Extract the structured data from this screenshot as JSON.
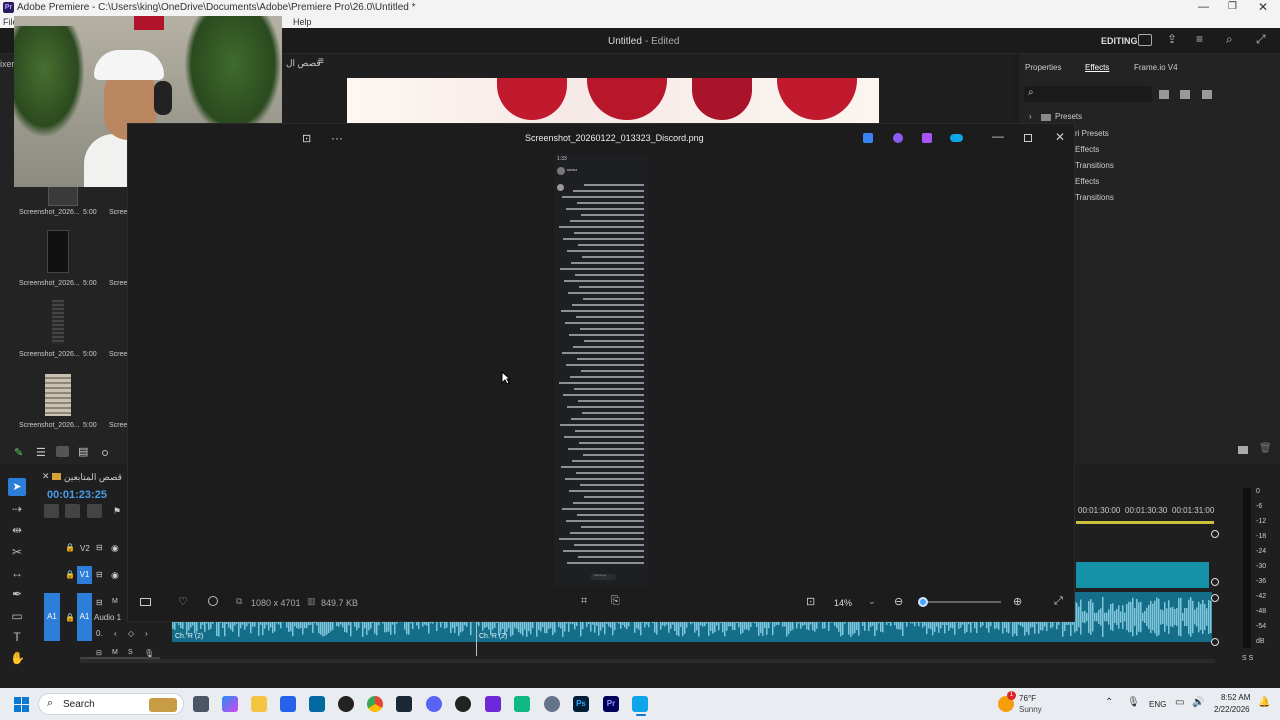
{
  "window": {
    "title": "Adobe Premiere - C:\\Users\\king\\OneDrive\\Documents\\Adobe\\Premiere Pro\\26.0\\Untitled *"
  },
  "menu": {
    "file": "File",
    "help": "Help"
  },
  "project_header": {
    "title": "Untitled",
    "status": "- Edited",
    "mode": "EDITING"
  },
  "panels": {
    "mixer_tab": "ixer",
    "source_tab": "قصص ال",
    "properties": "Properties",
    "effects": "Effects",
    "frameio": "Frame.io V4"
  },
  "effects_tree": [
    {
      "label": "Presets"
    },
    {
      "label": "ri Presets"
    },
    {
      "label": "Effects"
    },
    {
      "label": "Transitions"
    },
    {
      "label": "Effects"
    },
    {
      "label": "Transitions"
    }
  ],
  "project_items": [
    {
      "name": "Screenshot_2026...",
      "dur": "5:00",
      "name2": "Scree"
    },
    {
      "name": "Screenshot_2026...",
      "dur": "5:00",
      "name2": "Scree"
    },
    {
      "name": "Screenshot_2026...",
      "dur": "5:00",
      "name2": "Scree"
    },
    {
      "name": "Screenshot_2026...",
      "dur": "5:00",
      "name2": "Scree"
    }
  ],
  "viewer": {
    "filename": "Screenshot_20260122_013323_Discord.png",
    "dimensions": "1080 x 4701",
    "filesize": "849.7 KB",
    "zoom": "14%",
    "zoom_level": 0.0,
    "phone_time": "1:33 ",
    "phone_user": "sizmz",
    "phone_input": "Message"
  },
  "timeline": {
    "sequence_name": "قصص المتابعين",
    "timecode": "00:01:23:25",
    "ruler": [
      "00:01:30:00",
      "00:01:30:30",
      "00:01:31:00"
    ],
    "tracks": {
      "v2": "V2",
      "v1": "V1",
      "a1": "A1",
      "audio1": "Audio 1",
      "vol": "0.",
      "clip_label1": "Ch. R (2)",
      "clip_label2": "Ch. R (2)"
    },
    "meter_labels": [
      "0",
      "-6",
      "-12",
      "-18",
      "-24",
      "-30",
      "-36",
      "-42",
      "-48",
      "-54",
      "dB"
    ],
    "meter_ss": "S S"
  },
  "taskbar": {
    "search": "Search",
    "weather_temp": "76°F",
    "weather_desc": "Sunny",
    "lang": "ENG",
    "time": "8:52 AM",
    "date": "2/22/2026",
    "badge": "1"
  },
  "colors": {
    "accent": "#2d7ed8",
    "timecode": "#4a9be8",
    "waveform": "#7fc5dc",
    "audio_track": "#146e8a"
  }
}
